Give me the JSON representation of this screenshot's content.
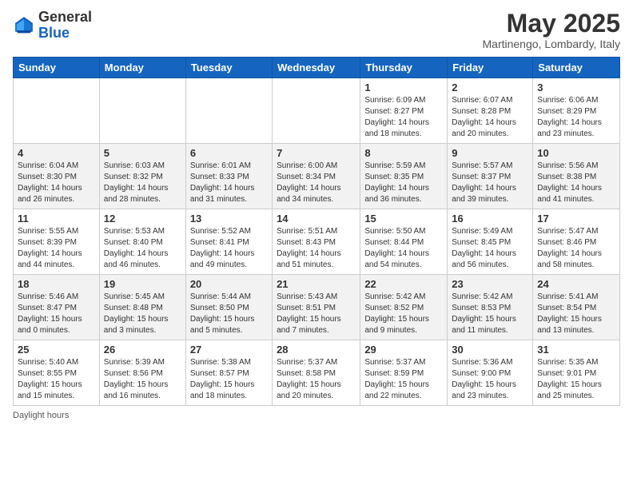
{
  "header": {
    "logo_general": "General",
    "logo_blue": "Blue",
    "month_title": "May 2025",
    "location": "Martinengo, Lombardy, Italy"
  },
  "weekdays": [
    "Sunday",
    "Monday",
    "Tuesday",
    "Wednesday",
    "Thursday",
    "Friday",
    "Saturday"
  ],
  "weeks": [
    [
      {
        "day": "",
        "info": ""
      },
      {
        "day": "",
        "info": ""
      },
      {
        "day": "",
        "info": ""
      },
      {
        "day": "",
        "info": ""
      },
      {
        "day": "1",
        "info": "Sunrise: 6:09 AM\nSunset: 8:27 PM\nDaylight: 14 hours\nand 18 minutes."
      },
      {
        "day": "2",
        "info": "Sunrise: 6:07 AM\nSunset: 8:28 PM\nDaylight: 14 hours\nand 20 minutes."
      },
      {
        "day": "3",
        "info": "Sunrise: 6:06 AM\nSunset: 8:29 PM\nDaylight: 14 hours\nand 23 minutes."
      }
    ],
    [
      {
        "day": "4",
        "info": "Sunrise: 6:04 AM\nSunset: 8:30 PM\nDaylight: 14 hours\nand 26 minutes."
      },
      {
        "day": "5",
        "info": "Sunrise: 6:03 AM\nSunset: 8:32 PM\nDaylight: 14 hours\nand 28 minutes."
      },
      {
        "day": "6",
        "info": "Sunrise: 6:01 AM\nSunset: 8:33 PM\nDaylight: 14 hours\nand 31 minutes."
      },
      {
        "day": "7",
        "info": "Sunrise: 6:00 AM\nSunset: 8:34 PM\nDaylight: 14 hours\nand 34 minutes."
      },
      {
        "day": "8",
        "info": "Sunrise: 5:59 AM\nSunset: 8:35 PM\nDaylight: 14 hours\nand 36 minutes."
      },
      {
        "day": "9",
        "info": "Sunrise: 5:57 AM\nSunset: 8:37 PM\nDaylight: 14 hours\nand 39 minutes."
      },
      {
        "day": "10",
        "info": "Sunrise: 5:56 AM\nSunset: 8:38 PM\nDaylight: 14 hours\nand 41 minutes."
      }
    ],
    [
      {
        "day": "11",
        "info": "Sunrise: 5:55 AM\nSunset: 8:39 PM\nDaylight: 14 hours\nand 44 minutes."
      },
      {
        "day": "12",
        "info": "Sunrise: 5:53 AM\nSunset: 8:40 PM\nDaylight: 14 hours\nand 46 minutes."
      },
      {
        "day": "13",
        "info": "Sunrise: 5:52 AM\nSunset: 8:41 PM\nDaylight: 14 hours\nand 49 minutes."
      },
      {
        "day": "14",
        "info": "Sunrise: 5:51 AM\nSunset: 8:43 PM\nDaylight: 14 hours\nand 51 minutes."
      },
      {
        "day": "15",
        "info": "Sunrise: 5:50 AM\nSunset: 8:44 PM\nDaylight: 14 hours\nand 54 minutes."
      },
      {
        "day": "16",
        "info": "Sunrise: 5:49 AM\nSunset: 8:45 PM\nDaylight: 14 hours\nand 56 minutes."
      },
      {
        "day": "17",
        "info": "Sunrise: 5:47 AM\nSunset: 8:46 PM\nDaylight: 14 hours\nand 58 minutes."
      }
    ],
    [
      {
        "day": "18",
        "info": "Sunrise: 5:46 AM\nSunset: 8:47 PM\nDaylight: 15 hours\nand 0 minutes."
      },
      {
        "day": "19",
        "info": "Sunrise: 5:45 AM\nSunset: 8:48 PM\nDaylight: 15 hours\nand 3 minutes."
      },
      {
        "day": "20",
        "info": "Sunrise: 5:44 AM\nSunset: 8:50 PM\nDaylight: 15 hours\nand 5 minutes."
      },
      {
        "day": "21",
        "info": "Sunrise: 5:43 AM\nSunset: 8:51 PM\nDaylight: 15 hours\nand 7 minutes."
      },
      {
        "day": "22",
        "info": "Sunrise: 5:42 AM\nSunset: 8:52 PM\nDaylight: 15 hours\nand 9 minutes."
      },
      {
        "day": "23",
        "info": "Sunrise: 5:42 AM\nSunset: 8:53 PM\nDaylight: 15 hours\nand 11 minutes."
      },
      {
        "day": "24",
        "info": "Sunrise: 5:41 AM\nSunset: 8:54 PM\nDaylight: 15 hours\nand 13 minutes."
      }
    ],
    [
      {
        "day": "25",
        "info": "Sunrise: 5:40 AM\nSunset: 8:55 PM\nDaylight: 15 hours\nand 15 minutes."
      },
      {
        "day": "26",
        "info": "Sunrise: 5:39 AM\nSunset: 8:56 PM\nDaylight: 15 hours\nand 16 minutes."
      },
      {
        "day": "27",
        "info": "Sunrise: 5:38 AM\nSunset: 8:57 PM\nDaylight: 15 hours\nand 18 minutes."
      },
      {
        "day": "28",
        "info": "Sunrise: 5:37 AM\nSunset: 8:58 PM\nDaylight: 15 hours\nand 20 minutes."
      },
      {
        "day": "29",
        "info": "Sunrise: 5:37 AM\nSunset: 8:59 PM\nDaylight: 15 hours\nand 22 minutes."
      },
      {
        "day": "30",
        "info": "Sunrise: 5:36 AM\nSunset: 9:00 PM\nDaylight: 15 hours\nand 23 minutes."
      },
      {
        "day": "31",
        "info": "Sunrise: 5:35 AM\nSunset: 9:01 PM\nDaylight: 15 hours\nand 25 minutes."
      }
    ]
  ],
  "footer": {
    "daylight_label": "Daylight hours"
  }
}
